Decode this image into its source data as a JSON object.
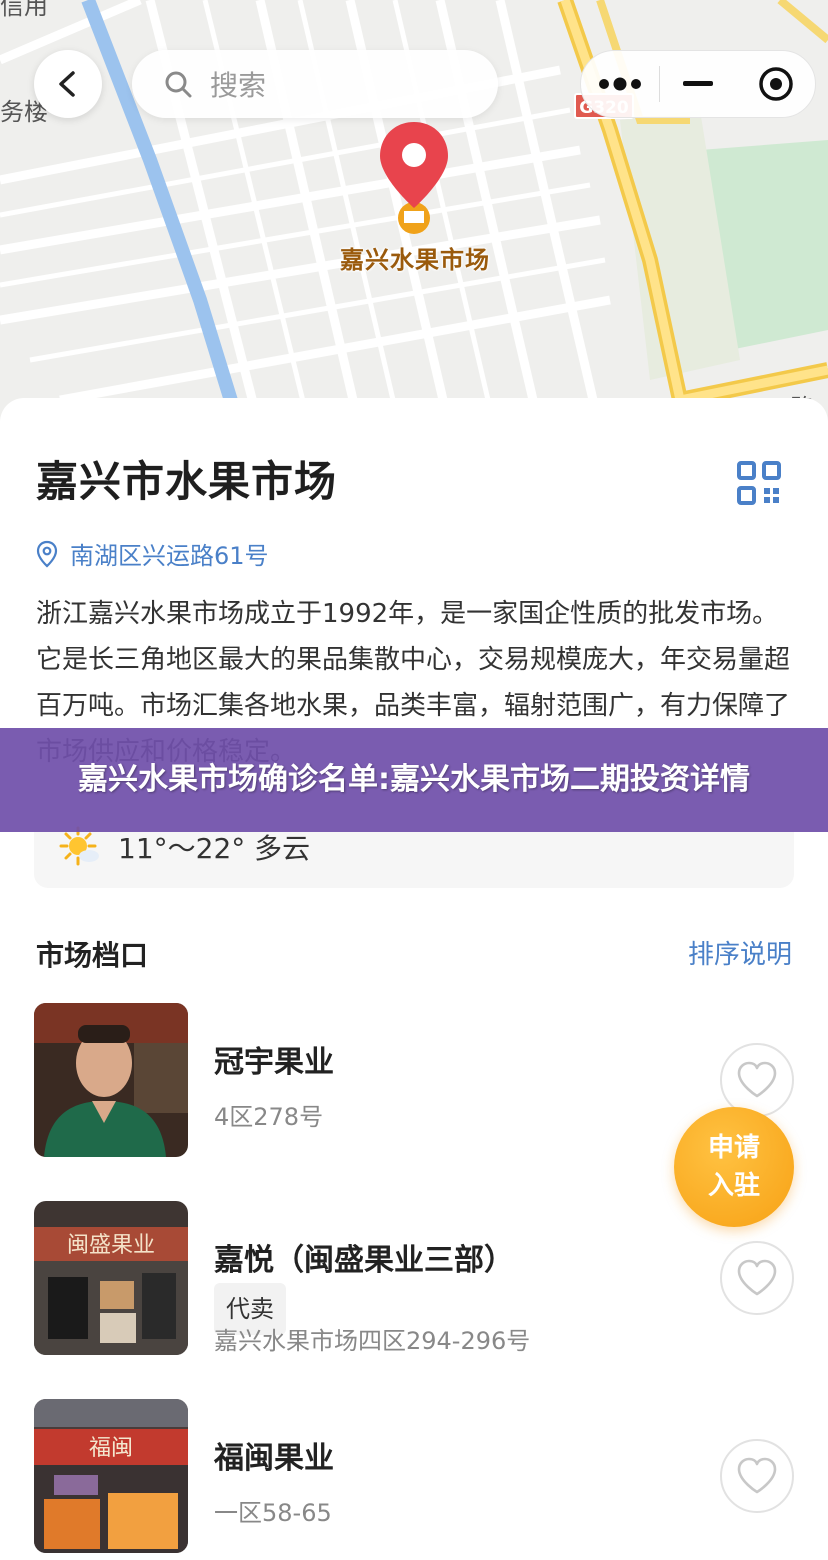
{
  "map": {
    "search_placeholder": "搜索",
    "pin_label": "嘉兴水果市场",
    "road_sign": "G320",
    "label_left": "务楼",
    "label_top": "信用",
    "label_right": "路"
  },
  "market": {
    "title": "嘉兴市水果市场",
    "address": "南湖区兴运路61号",
    "description": "浙江嘉兴水果市场成立于1992年，是一家国企性质的批发市场。它是长三角地区最大的果品集散中心，交易规模庞大，年交易量超百万吨。市场汇集各地水果，品类丰富，辐射范围广，有力保障了市场供应和价格稳定。",
    "weather": "11°～22° 多云"
  },
  "section": {
    "title": "市场档口",
    "link": "排序说明"
  },
  "stalls": [
    {
      "name": "冠宇果业",
      "tag": "",
      "location": "4区278号"
    },
    {
      "name": "嘉悦（闽盛果业三部）",
      "tag": "代卖",
      "location": "嘉兴水果市场四区294-296号",
      "sign": "闽盛果业"
    },
    {
      "name": "福闽果业",
      "tag": "",
      "location": "一区58-65",
      "sign": "福闽"
    }
  ],
  "fab": {
    "line1": "申请",
    "line2": "入驻"
  },
  "banner": "嘉兴水果市场确诊名单:嘉兴水果市场二期投资详情",
  "colors": {
    "accent": "#4a80c8",
    "fab": "#f7a114",
    "banner": "#7050aa",
    "pin": "#e8444d"
  }
}
